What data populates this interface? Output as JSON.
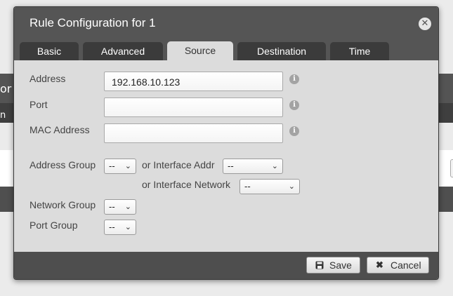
{
  "dialog": {
    "title": "Rule Configuration for 1",
    "close_glyph": "✕"
  },
  "background": {
    "fragment_or": "or",
    "fragment_n": "n"
  },
  "tabs": [
    {
      "label": "Basic",
      "active": false
    },
    {
      "label": "Advanced",
      "active": false
    },
    {
      "label": "Source",
      "active": true
    },
    {
      "label": "Destination",
      "active": false
    },
    {
      "label": "Time",
      "active": false
    }
  ],
  "fields": {
    "address": {
      "label": "Address",
      "value": "192.168.10.123",
      "info_icon": "info-icon"
    },
    "port": {
      "label": "Port",
      "value": "",
      "info_icon": "info-icon"
    },
    "mac": {
      "label": "MAC Address",
      "value": "",
      "info_icon": "info-icon"
    }
  },
  "groups": {
    "address_group": {
      "label": "Address Group",
      "selected": "--"
    },
    "interface_addr": {
      "label": "or Interface Addr",
      "selected": "--"
    },
    "interface_network": {
      "label": "or Interface Network",
      "selected": "--"
    },
    "network_group": {
      "label": "Network Group",
      "selected": "--"
    },
    "port_group": {
      "label": "Port Group",
      "selected": "--"
    }
  },
  "footer": {
    "save_label": "Save",
    "cancel_label": "Cancel",
    "save_icon": "floppy-disk-icon",
    "cancel_icon": "x-icon"
  },
  "colors": {
    "header_bg": "#555555",
    "tab_bg": "#3b3b3b",
    "body_bg": "#dcdcdc",
    "footer_bg": "#4e4e4e"
  }
}
